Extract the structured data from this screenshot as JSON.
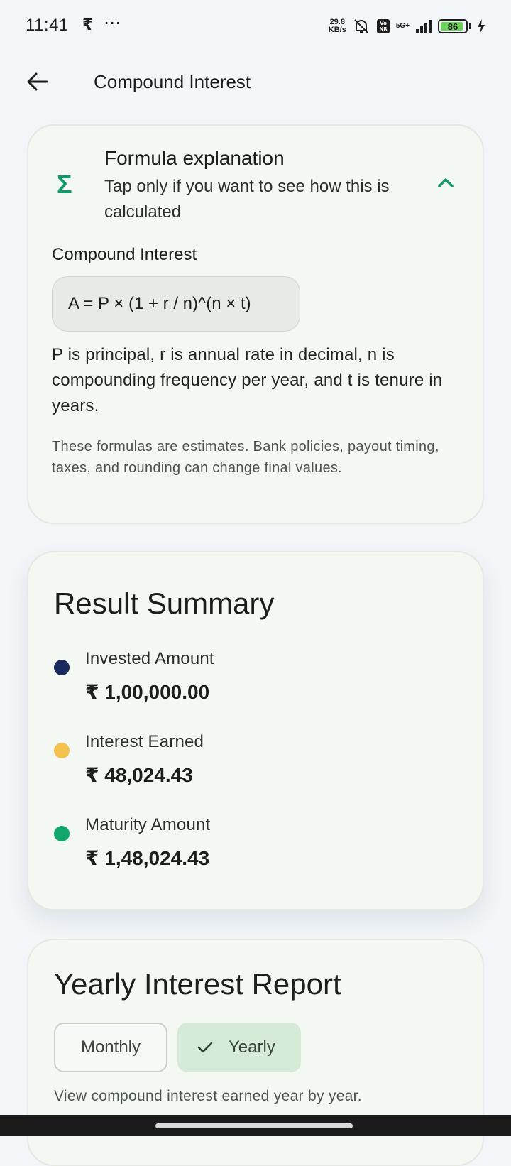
{
  "status_bar": {
    "time": "11:41",
    "notif_icon": "rupee-icon",
    "more": "⋯",
    "speed_value": "29.8",
    "speed_unit": "KB/s",
    "network": "5G+",
    "volte": "Vo NR",
    "battery": "86"
  },
  "app_bar": {
    "title": "Compound Interest"
  },
  "formula_card": {
    "title": "Formula explanation",
    "subtitle": "Tap only if you want to see how this is calculated",
    "section_label": "Compound Interest",
    "formula": "A = P × (1 + r / n)^(n × t)",
    "description": "P is principal, r is annual rate in decimal, n is compounding frequency per year, and t is tenure in years.",
    "note": "These formulas are estimates. Bank policies, payout timing, taxes, and rounding can change final values."
  },
  "result_summary": {
    "title": "Result Summary",
    "items": [
      {
        "label": "Invested Amount",
        "value": "₹ 1,00,000.00",
        "color": "#1a2a5e"
      },
      {
        "label": "Interest Earned",
        "value": "₹ 48,024.43",
        "color": "#f2c14e"
      },
      {
        "label": "Maturity Amount",
        "value": "₹ 1,48,024.43",
        "color": "#12a66a"
      }
    ]
  },
  "yearly_report": {
    "title": "Yearly Interest Report",
    "chip_monthly": "Monthly",
    "chip_yearly": "Yearly",
    "selected": "Yearly",
    "description": "View compound interest earned year by year."
  },
  "colors": {
    "accent": "#109868",
    "background": "#f2f6f9",
    "card": "#f3f8f3",
    "chip_selected": "#d5ebd7"
  }
}
